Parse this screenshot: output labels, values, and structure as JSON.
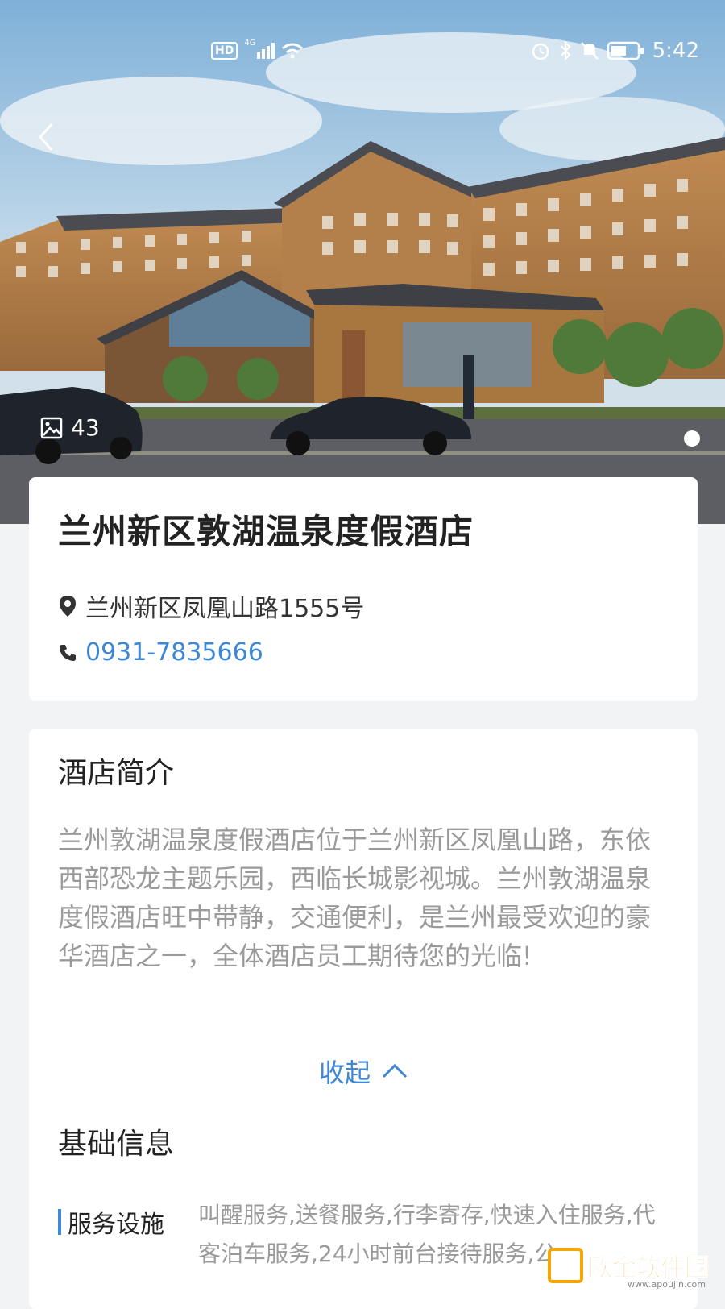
{
  "status_bar": {
    "network": "4G",
    "hd": "HD",
    "time": "5:42"
  },
  "gallery": {
    "photo_count": "43"
  },
  "hotel": {
    "name": "兰州新区敦湖温泉度假酒店",
    "address": "兰州新区凤凰山路1555号",
    "phone": "0931-7835666"
  },
  "intro": {
    "title": "酒店简介",
    "text": "兰州敦湖温泉度假酒店位于兰州新区凤凰山路，东依西部恐龙主题乐园，西临长城影视城。兰州敦湖温泉度假酒店旺中带静，交通便利，是兰州最受欢迎的豪华酒店之一，全体酒店员工期待您的光临!",
    "collapse_label": "收起"
  },
  "basic_info": {
    "title": "基础信息",
    "items": [
      {
        "label": "服务设施",
        "value": "叫醒服务,送餐服务,行李寄存,快速入住服务,代客泊车服务,24小时前台接待服务,公"
      }
    ]
  },
  "watermark": {
    "text": "欧金软件园",
    "sub": "www.apoujin.com"
  },
  "colors": {
    "accent": "#3d87d6",
    "page_bg": "#f2f3f5"
  }
}
